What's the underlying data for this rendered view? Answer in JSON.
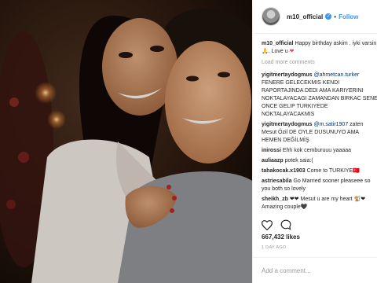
{
  "post": {
    "author": "m10_official",
    "follow_label": "Follow",
    "dot": "•",
    "caption_user": "m10_official",
    "caption_text": "Happy birthday askim . iyki varsin",
    "caption_emoji": "🙏",
    "caption_end": ". Love u",
    "caption_heart": "❤",
    "load_more": "Load more comments",
    "comments": [
      {
        "user": "yigitmertaydogmus",
        "mention": "@ahmetcan.turker",
        "text": "FENERE GELECEKMIS KENDI RAPORTAJINDA DEDI AMA KARIYERINI NOKTALAYACAGI ZAMANDAN BIRKAC SENE ONCE GELIP TURKIYEDE NOKTALAYACAKMIS"
      },
      {
        "user": "yigitmertaydogmus",
        "mention": "@m.satir1907",
        "text": "zaten Mesut Özil DE OYLE DUSUNUYO AMA HEMEN DEĞİLMİŞ"
      },
      {
        "user": "inirossi",
        "mention": "",
        "text": "Ehh kok cemburuuu yaaaaa"
      },
      {
        "user": "auliaazp",
        "mention": "",
        "text": "potek saia:("
      },
      {
        "user": "tahakocak.x1903",
        "mention": "",
        "text": "Come to TURKIYE🇹🇷"
      },
      {
        "user": "astriesabila",
        "mention": "",
        "text": "Go Married sooner pleaseee so you both so lovely"
      },
      {
        "user": "sheikh_zb",
        "mention": "",
        "text": "❤❤ Mesut u are my heart 🐒❤ Amazing couple🖤"
      }
    ],
    "likes": "667,432 likes",
    "time_ago": "1 DAY AGO",
    "add_comment_placeholder": "Add a comment..."
  },
  "icons": [
    "heart-icon",
    "comment-icon",
    "verified-icon",
    "avatar"
  ],
  "colors": {
    "link": "#3897f0",
    "mention": "#003569",
    "muted": "#999999",
    "text": "#262626",
    "heart": "#ed4956"
  }
}
